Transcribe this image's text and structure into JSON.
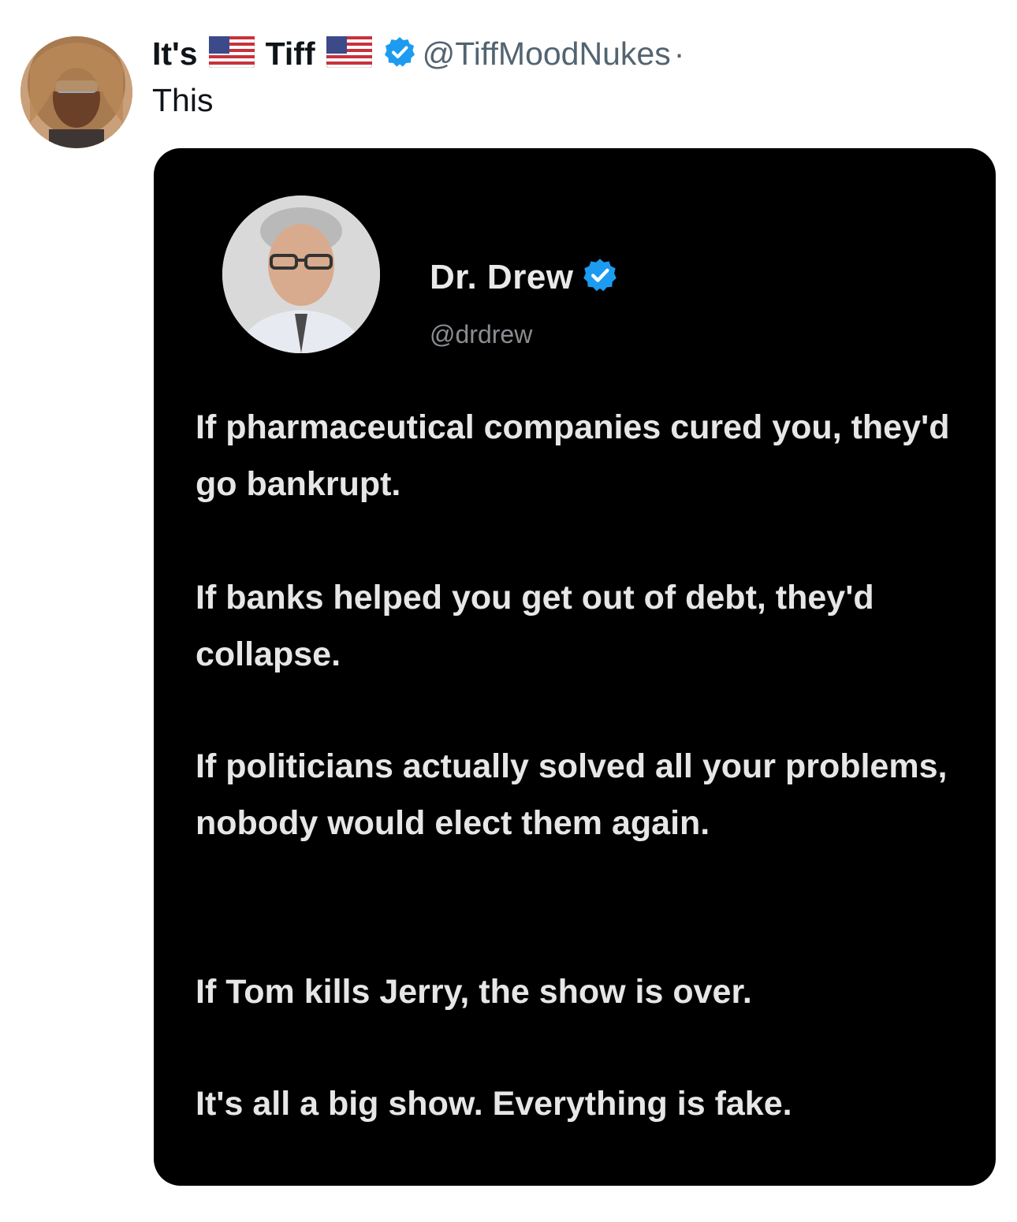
{
  "tweet": {
    "author": {
      "name_part_1": "It's",
      "name_part_2": "Tiff",
      "handle": "@TiffMoodNukes",
      "separator": "·",
      "flag_icon": "us-flag-icon",
      "verified_icon": "verified-badge-icon",
      "verified_color": "#1d9bf0"
    },
    "text": "This",
    "media": {
      "author_name": "Dr. Drew",
      "author_handle": "@drdrew",
      "verified_icon": "verified-badge-icon",
      "paragraphs": [
        "If pharmaceutical companies cured you, they'd go bankrupt.",
        "If banks helped you get out of debt, they'd collapse.",
        "If politicians actually solved all your problems, nobody would elect them again.",
        "If Tom kills Jerry, the show is over.",
        "It's all a big show. Everything is fake."
      ]
    }
  }
}
